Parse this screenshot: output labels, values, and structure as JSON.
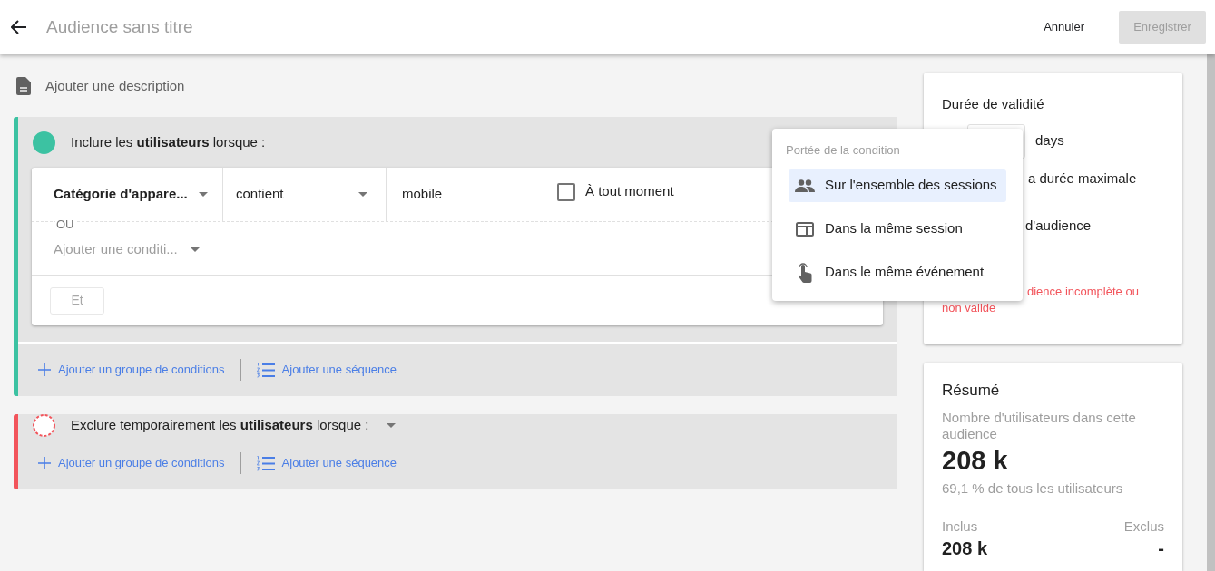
{
  "header": {
    "title": "Audience sans titre",
    "cancel": "Annuler",
    "save": {
      "label": "Enregistrer",
      "disabled": true
    }
  },
  "description": "Ajouter une description",
  "groups": [
    {
      "kind": "include",
      "color": "#3cc2a2",
      "heading": "Inclure les **utilisateurs** lorsque :",
      "condition": {
        "dimension": "Catégorie d'appare...",
        "operator": "contient",
        "value": "mobile",
        "anytime": {
          "label": "À tout moment",
          "checked": false
        }
      },
      "or_label": "OU",
      "add_condition": "Ajouter une conditi...",
      "and_button": {
        "label": "Et",
        "disabled": true
      },
      "actions": [
        "Ajouter un groupe de conditions",
        "Ajouter une séquence"
      ]
    },
    {
      "kind": "exclude",
      "color": "#f2545b",
      "heading": "Exclure temporairement les **utilisateurs** lorsque :",
      "actions": [
        "Ajouter un groupe de conditions",
        "Ajouter une séquence"
      ]
    }
  ],
  "scope_menu": {
    "title": "Portée de la condition",
    "items": [
      {
        "label": "Sur l'ensemble des sessions",
        "selected": true
      },
      {
        "label": "Dans la même session",
        "selected": false
      },
      {
        "label": "Dans le même événement",
        "selected": false
      }
    ]
  },
  "validity": {
    "title": "Durée de validité",
    "unit": "days",
    "line_1": "a durée maximale",
    "line_2": "d'audience",
    "error": [
      "dience incomplète ou",
      "non valide"
    ]
  },
  "summary": {
    "title": "Résumé",
    "subtitle": "Nombre d'utilisateurs dans cette audience",
    "value": "208 k",
    "share": "69,1 % de tous les utilisateurs",
    "included": {
      "label": "Inclus",
      "value": "208 k"
    },
    "excluded": {
      "label": "Exclus",
      "value": "-"
    }
  }
}
